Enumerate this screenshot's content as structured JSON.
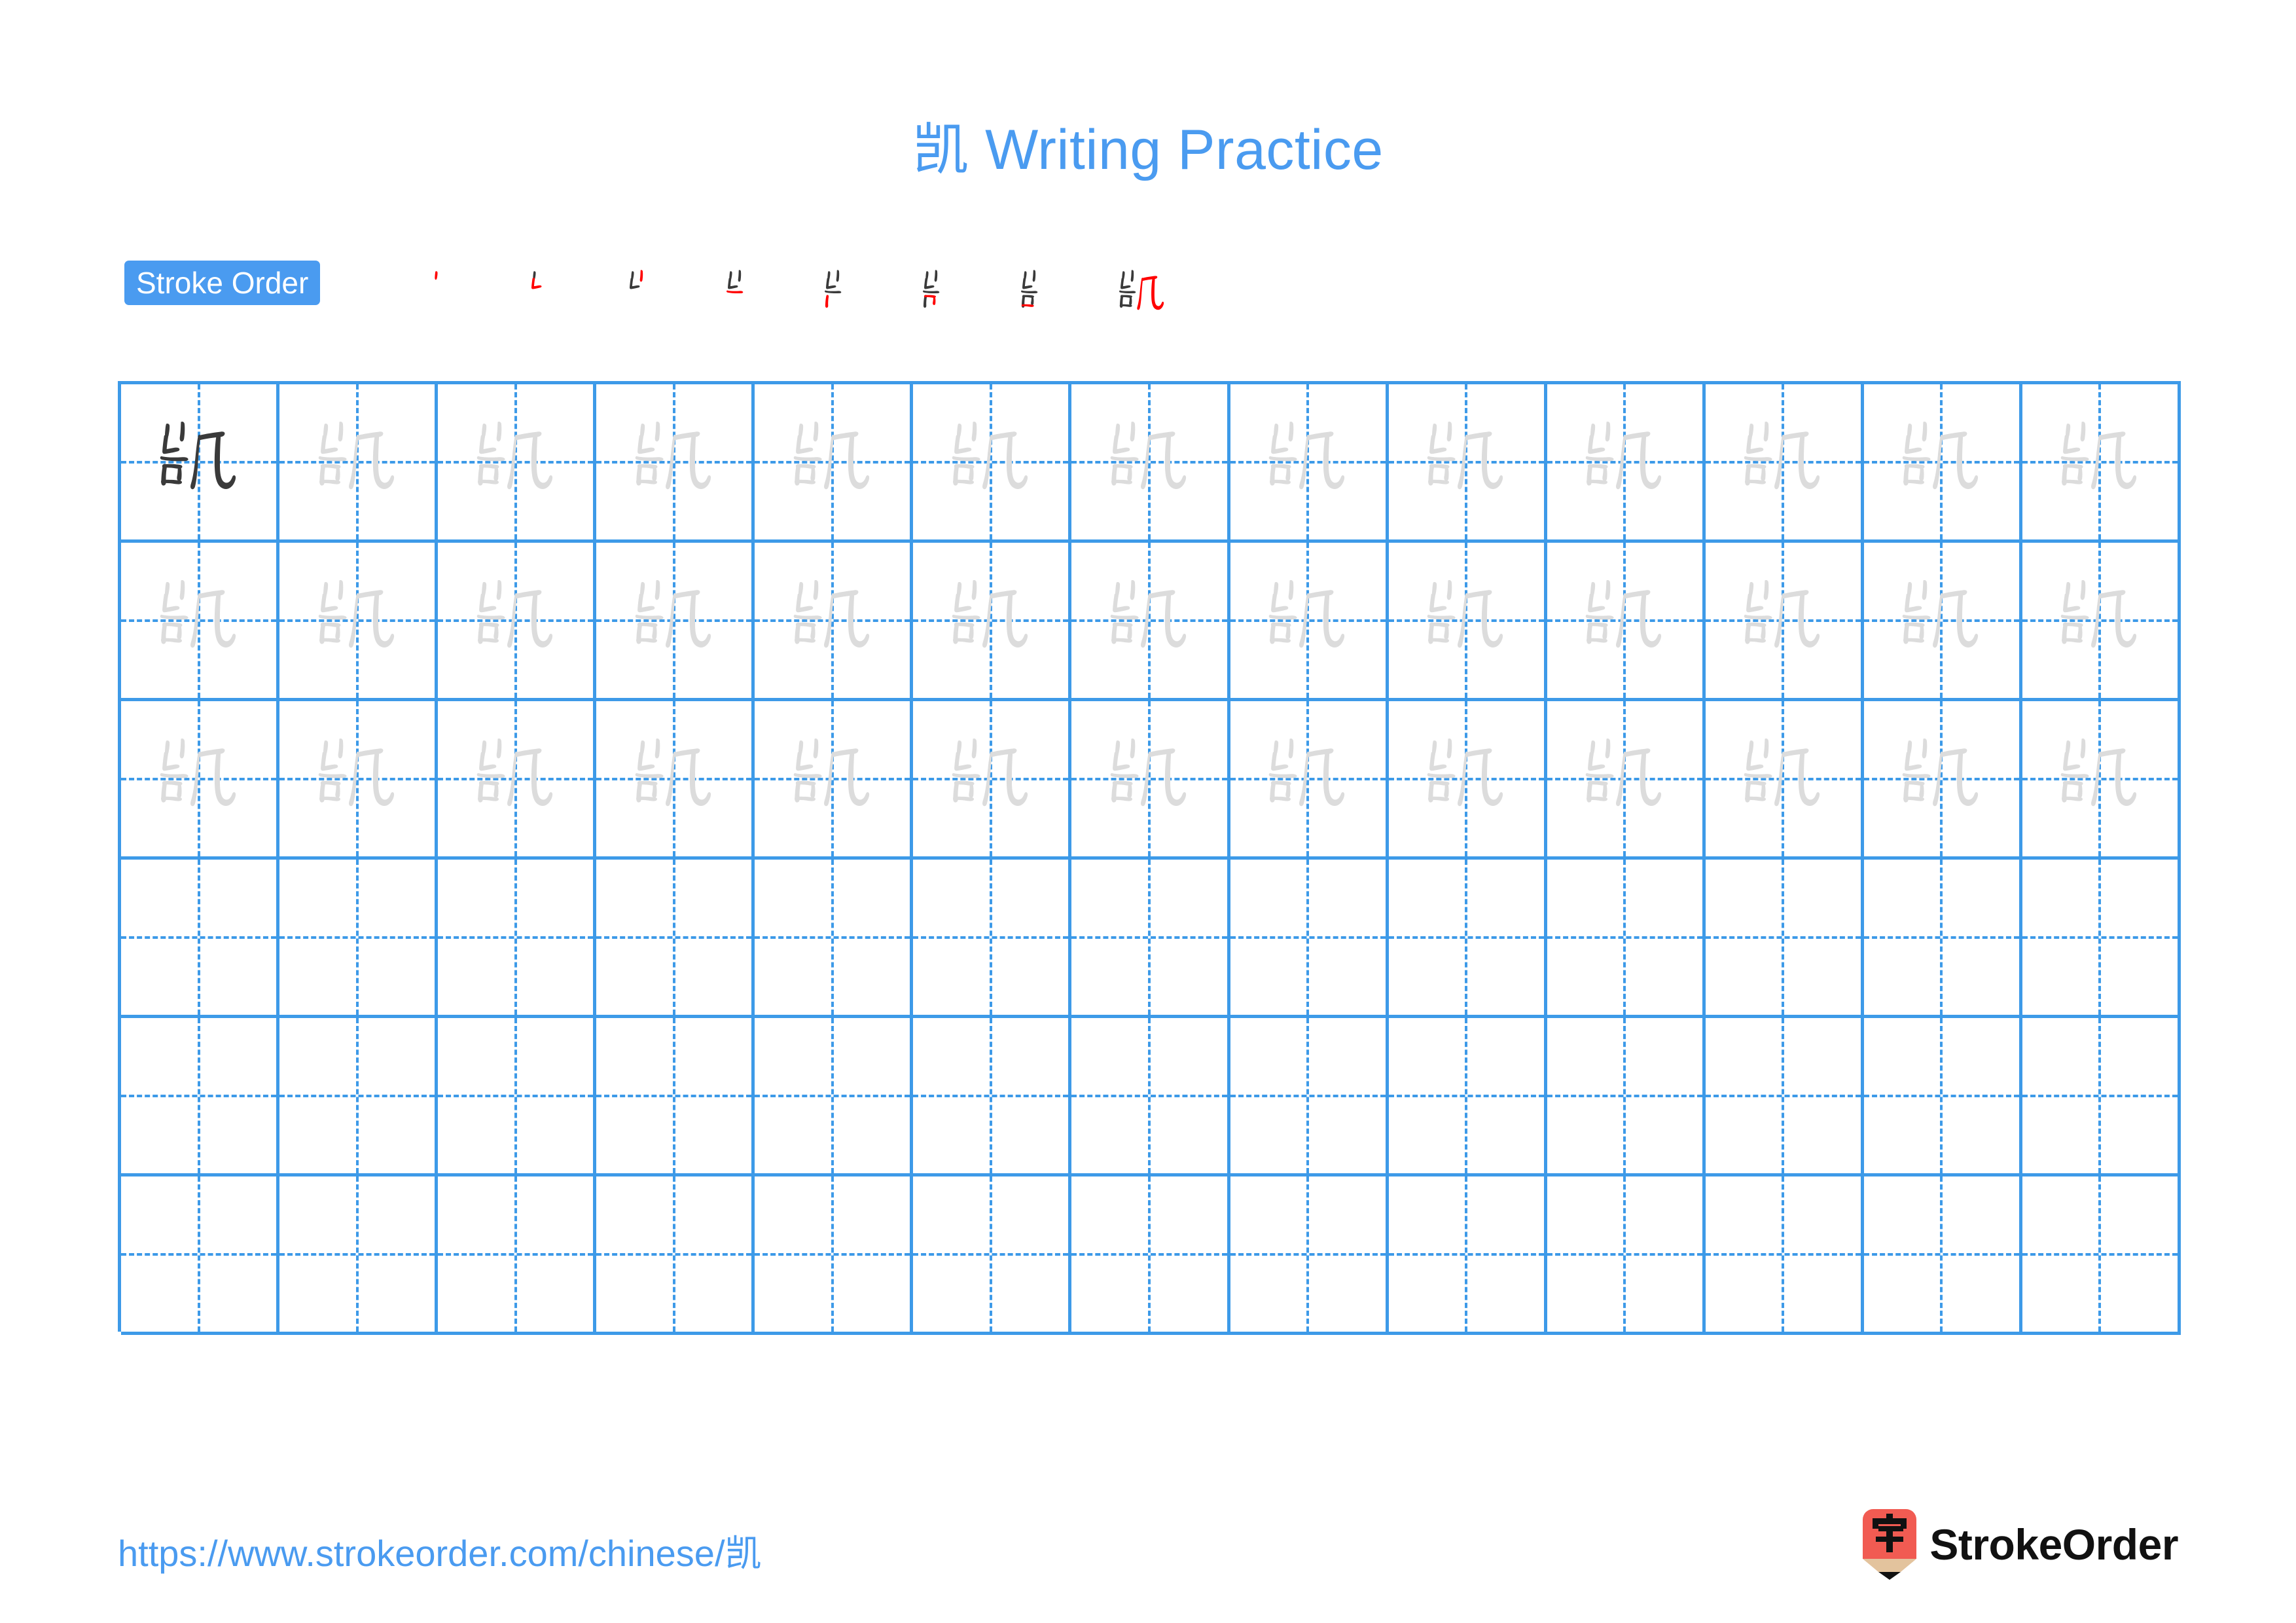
{
  "character": "凯",
  "title": {
    "character": "凯",
    "text": " Writing Practice",
    "full": "凯 Writing Practice",
    "color": "#4A9BF0"
  },
  "stroke_order": {
    "label": "Stroke Order",
    "badge_bg": "#4A9BF0",
    "badge_text_color": "#ffffff",
    "new_stroke_color": "#ff0000",
    "prior_stroke_color": "#3a3a3a",
    "total_strokes": 8,
    "steps": [
      {
        "index": 1,
        "strokes_shown": 1,
        "new_stroke_index": 1,
        "partial": "丨"
      },
      {
        "index": 2,
        "strokes_shown": 2,
        "new_stroke_index": 2,
        "partial": "屮"
      },
      {
        "index": 3,
        "strokes_shown": 3,
        "new_stroke_index": 3,
        "partial": "山"
      },
      {
        "index": 4,
        "strokes_shown": 4,
        "new_stroke_index": 4,
        "partial": "屵"
      },
      {
        "index": 5,
        "strokes_shown": 5,
        "new_stroke_index": 5,
        "partial": "峃"
      },
      {
        "index": 6,
        "strokes_shown": 6,
        "new_stroke_index": 6,
        "partial": "岂"
      },
      {
        "index": 7,
        "strokes_shown": 7,
        "new_stroke_index": 7,
        "partial": "訾"
      },
      {
        "index": 8,
        "strokes_shown": 8,
        "new_stroke_index": 8,
        "partial": "凯"
      }
    ]
  },
  "grid": {
    "columns": 13,
    "rows": 6,
    "line_color": "#3d9ae8",
    "guide_color": "#3d9ae8",
    "dark_char_color": "#3a3a3a",
    "trace_char_color": "#dcdcdc",
    "row_types": [
      "traced",
      "traced",
      "traced",
      "empty",
      "empty",
      "empty"
    ],
    "first_cell_is_dark": true
  },
  "footer": {
    "url": "https://www.strokeorder.com/chinese/凯",
    "url_color": "#4A9BF0",
    "brand_name": "StrokeOrder",
    "logo": {
      "icon_char": "字",
      "body_color": "#F15B52",
      "wood_color": "#E3C39D",
      "tip_color": "#111111"
    }
  }
}
